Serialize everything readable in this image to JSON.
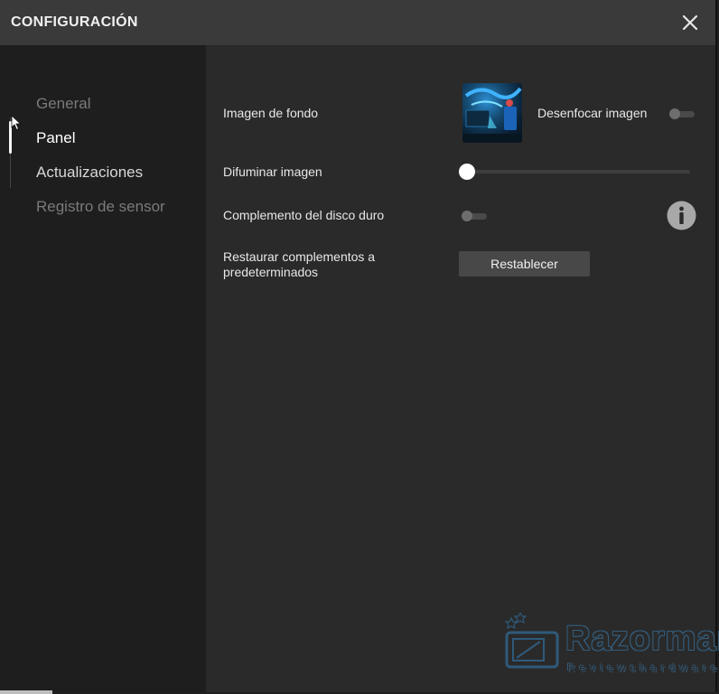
{
  "window": {
    "title": "CONFIGURACIÓN"
  },
  "sidebar": {
    "items": [
      {
        "label": "General",
        "state": "muted"
      },
      {
        "label": "Panel",
        "state": "active"
      },
      {
        "label": "Actualizaciones",
        "state": "normal"
      },
      {
        "label": "Registro de sensor",
        "state": "muted"
      }
    ]
  },
  "panel": {
    "background_image": {
      "label": "Imagen de fondo"
    },
    "blur_toggle": {
      "label": "Desenfocar imagen",
      "on": false
    },
    "fade_slider": {
      "label": "Difuminar imagen",
      "value": 0
    },
    "hdd_plugin": {
      "label": "Complemento del disco duro",
      "on": false
    },
    "restore": {
      "label": "Restaurar complementos a predeterminados",
      "button_label": "Restablecer"
    }
  },
  "watermark": {
    "brand": "Razorman",
    "tagline": "Reviewshardware"
  },
  "colors": {
    "accent": "#ffffff",
    "background": "#2a2a2a",
    "sidebar": "#1e1e1e",
    "titlebar": "#3a3a3a"
  },
  "icons": [
    "close-icon",
    "info-icon",
    "mouse-cursor-icon",
    "background-thumbnail"
  ]
}
